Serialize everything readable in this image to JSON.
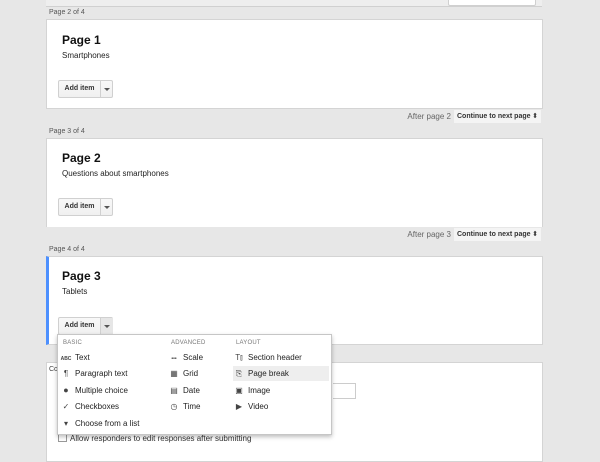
{
  "pages": [
    {
      "tab": "Page 2 of 4",
      "title": "Page 1",
      "desc": "Smartphones"
    },
    {
      "tab": "Page 3 of 4",
      "title": "Page 2",
      "desc": "Questions about smartphones"
    },
    {
      "tab": "Page 4 of 4",
      "title": "Page 3",
      "desc": "Tablets"
    }
  ],
  "add_item_label": "Add item",
  "nav": [
    {
      "after": "After page 2",
      "select": "Continue to next page"
    },
    {
      "after": "After page 3",
      "select": "Continue to next page"
    }
  ],
  "menu": {
    "basic": {
      "heading": "BASIC",
      "items": [
        {
          "icon": "ABC",
          "label": "Text"
        },
        {
          "icon": "¶",
          "label": "Paragraph text"
        },
        {
          "icon": "●",
          "label": "Multiple choice"
        },
        {
          "icon": "✓",
          "label": "Checkboxes"
        },
        {
          "icon": "▾",
          "label": "Choose from a list"
        }
      ]
    },
    "advanced": {
      "heading": "ADVANCED",
      "items": [
        {
          "icon": "•••",
          "label": "Scale"
        },
        {
          "icon": "▦",
          "label": "Grid"
        },
        {
          "icon": "▤",
          "label": "Date"
        },
        {
          "icon": "◷",
          "label": "Time"
        }
      ]
    },
    "layout": {
      "heading": "LAYOUT",
      "items": [
        {
          "icon": "T⫾",
          "label": "Section header"
        },
        {
          "icon": "⎘",
          "label": "Page break"
        },
        {
          "icon": "▣",
          "label": "Image"
        },
        {
          "icon": "▶",
          "label": "Video"
        }
      ]
    }
  },
  "settings": {
    "cut_label": "Co",
    "checkbox_label": "Allow responders to edit responses after submitting"
  }
}
